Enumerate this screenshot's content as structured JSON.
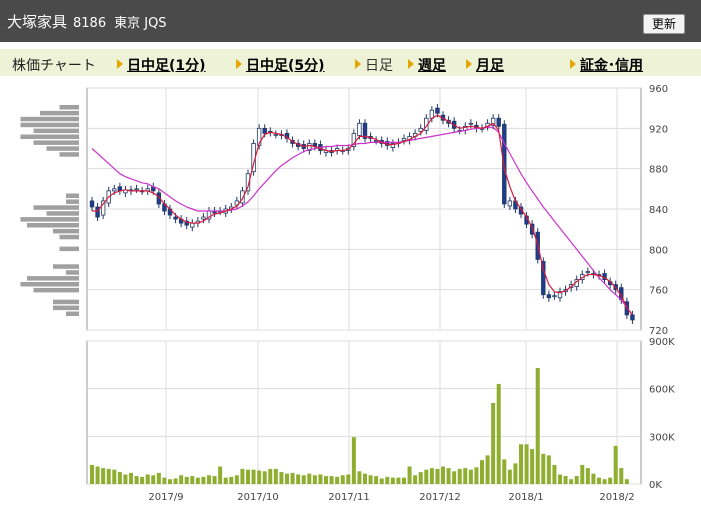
{
  "header": {
    "company": "大塚家具",
    "code": "8186",
    "market": "東京 JQS",
    "update_label": "更新"
  },
  "tabs": {
    "label": "株価チャート",
    "items": [
      {
        "label": "日中足(1分)",
        "style": "link"
      },
      {
        "label": "日中足(5分)",
        "style": "link"
      },
      {
        "label": "日足",
        "style": "plain"
      },
      {
        "label": "週足",
        "style": "link"
      },
      {
        "label": "月足",
        "style": "link"
      },
      {
        "label": "証金･信用",
        "style": "link"
      }
    ]
  },
  "chart_data": {
    "type": "candlestick",
    "price_axis": {
      "min": 720,
      "max": 960,
      "ticks": [
        960,
        920,
        880,
        840,
        800,
        760,
        720
      ]
    },
    "volume_axis": {
      "min": 0,
      "max": 900000,
      "ticks": [
        "900K",
        "600K",
        "300K",
        "0K"
      ]
    },
    "x_labels": [
      "2017/9",
      "2017/10",
      "2017/11",
      "2017/12",
      "2018/1",
      "2018/2"
    ],
    "closes": [
      842,
      832,
      848,
      858,
      860,
      858,
      859,
      858,
      860,
      858,
      860,
      858,
      845,
      838,
      834,
      830,
      826,
      824,
      826,
      828,
      832,
      838,
      836,
      838,
      840,
      842,
      848,
      858,
      875,
      905,
      920,
      915,
      916,
      914,
      913,
      910,
      905,
      902,
      900,
      905,
      902,
      898,
      898,
      896,
      900,
      898,
      900,
      915,
      925,
      910,
      910,
      908,
      905,
      903,
      905,
      906,
      910,
      912,
      915,
      920,
      930,
      938,
      935,
      928,
      925,
      920,
      918,
      922,
      925,
      920,
      920,
      925,
      930,
      922,
      845,
      848,
      840,
      835,
      825,
      815,
      790,
      755,
      752,
      754,
      758,
      760,
      765,
      770,
      775,
      778,
      775,
      774,
      770,
      765,
      760,
      750,
      735,
      730
    ],
    "ma_short": [
      838,
      838,
      845,
      852,
      856,
      858,
      859,
      858,
      858,
      858,
      858,
      856,
      852,
      845,
      840,
      834,
      830,
      827,
      826,
      826,
      828,
      832,
      835,
      836,
      838,
      840,
      843,
      850,
      862,
      885,
      905,
      914,
      916,
      915,
      914,
      911,
      907,
      904,
      902,
      903,
      902,
      900,
      898,
      897,
      898,
      898,
      899,
      905,
      912,
      912,
      911,
      909,
      906,
      904,
      904,
      905,
      907,
      909,
      912,
      915,
      922,
      930,
      933,
      930,
      927,
      923,
      920,
      921,
      922,
      921,
      920,
      922,
      925,
      918,
      880,
      862,
      848,
      840,
      832,
      822,
      805,
      780,
      765,
      758,
      757,
      759,
      763,
      768,
      772,
      775,
      775,
      774,
      772,
      768,
      762,
      754,
      742,
      735
    ],
    "ma_long": [
      900,
      895,
      890,
      885,
      880,
      875,
      872,
      870,
      868,
      866,
      865,
      862,
      860,
      856,
      852,
      848,
      845,
      842,
      840,
      838,
      838,
      838,
      838,
      838,
      838,
      839,
      840,
      843,
      847,
      853,
      860,
      866,
      872,
      878,
      883,
      887,
      891,
      894,
      897,
      899,
      900,
      901,
      902,
      902,
      903,
      903,
      903,
      904,
      905,
      905,
      906,
      906,
      906,
      906,
      906,
      906,
      907,
      908,
      909,
      910,
      911,
      912,
      913,
      914,
      915,
      916,
      917,
      918,
      919,
      920,
      920,
      921,
      921,
      916,
      905,
      895,
      885,
      875,
      866,
      858,
      850,
      842,
      835,
      828,
      821,
      814,
      807,
      800,
      793,
      786,
      779,
      772,
      766,
      760,
      755,
      750,
      742,
      735
    ],
    "volumes": [
      120,
      110,
      100,
      95,
      90,
      75,
      60,
      70,
      50,
      45,
      60,
      55,
      70,
      40,
      30,
      35,
      55,
      45,
      50,
      40,
      45,
      55,
      50,
      110,
      40,
      45,
      55,
      95,
      90,
      90,
      85,
      80,
      95,
      95,
      75,
      65,
      70,
      60,
      55,
      65,
      55,
      60,
      50,
      50,
      45,
      55,
      60,
      295,
      80,
      65,
      55,
      50,
      35,
      45,
      40,
      40,
      40,
      110,
      55,
      75,
      90,
      100,
      95,
      110,
      100,
      80,
      95,
      100,
      90,
      105,
      150,
      180,
      510,
      630,
      155,
      90,
      130,
      250,
      250,
      220,
      730,
      190,
      180,
      120,
      60,
      50,
      30,
      50,
      120,
      100,
      65,
      40,
      30,
      40,
      240,
      100,
      30
    ]
  }
}
